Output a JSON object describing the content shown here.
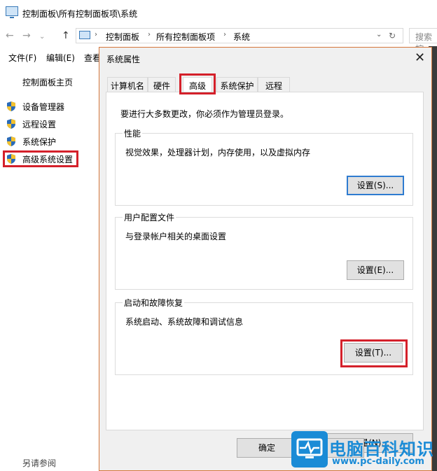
{
  "window": {
    "title": "控制面板\\所有控制面板项\\系统",
    "breadcrumb": [
      "控制面板",
      "所有控制面板项",
      "系统"
    ],
    "search_placeholder": "搜索控"
  },
  "menu": [
    "文件(F)",
    "编辑(E)",
    "查看"
  ],
  "left_pane": {
    "home": "控制面板主页",
    "links": [
      "设备管理器",
      "远程设置",
      "系统保护",
      "高级系统设置"
    ],
    "see_also": "另请参阅"
  },
  "dialog": {
    "title": "系统属性",
    "tabs": [
      "计算机名",
      "硬件",
      "高级",
      "系统保护",
      "远程"
    ],
    "notice": "要进行大多数更改，你必须作为管理员登录。",
    "groups": [
      {
        "title": "性能",
        "desc": "视觉效果，处理器计划，内存使用，以及虚拟内存",
        "button": "设置(S)..."
      },
      {
        "title": "用户配置文件",
        "desc": "与登录帐户相关的桌面设置",
        "button": "设置(E)..."
      },
      {
        "title": "启动和故障恢复",
        "desc": "系统启动、系统故障和调试信息",
        "button": "设置(T)..."
      }
    ],
    "env_button": "环境变量(N)...",
    "ok_button": "确定"
  },
  "watermark": {
    "name": "电脑百科知识",
    "url": "www.pc-daily.com"
  },
  "colors": {
    "highlight_red": "#d4202a",
    "accent_blue": "#1a8bd6",
    "dialog_bg": "#f0f0f0"
  }
}
